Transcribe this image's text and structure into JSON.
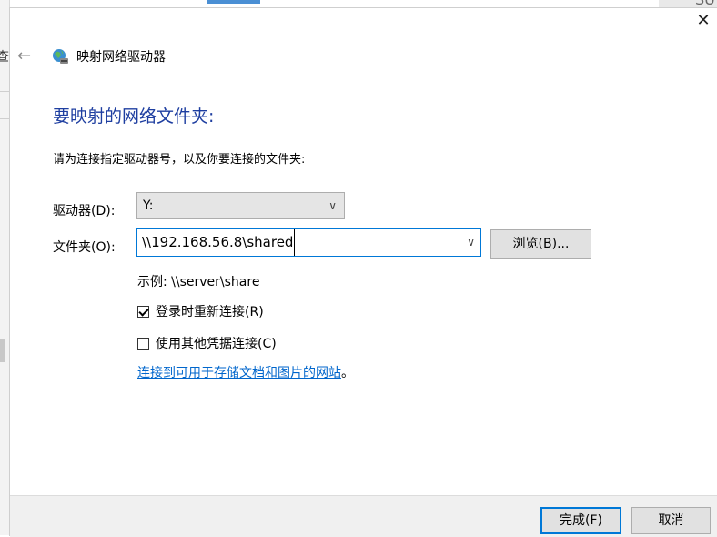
{
  "background": {
    "left_fragment": "查",
    "top_right_fragment": "SU"
  },
  "window": {
    "title": "映射网络驱动器",
    "close_glyph": "✕",
    "back_glyph": "←"
  },
  "heading": "要映射的网络文件夹:",
  "instruction": "请为连接指定驱动器号，以及你要连接的文件夹:",
  "drive": {
    "label": "驱动器(D):",
    "selected": "Y:"
  },
  "folder": {
    "label": "文件夹(O):",
    "value": "\\\\192.168.56.8\\shared"
  },
  "browse_label": "浏览(B)...",
  "example": "示例: \\\\server\\share",
  "checkboxes": [
    {
      "label": "登录时重新连接(R)",
      "checked": true
    },
    {
      "label": "使用其他凭据连接(C)",
      "checked": false
    }
  ],
  "link": {
    "text": "连接到可用于存储文档和图片的网站",
    "suffix": "。"
  },
  "buttons": {
    "finish": "完成(F)",
    "cancel": "取消"
  },
  "colors": {
    "heading": "#1e3ea0",
    "link": "#0066cc",
    "focus_border": "#0078d7"
  }
}
